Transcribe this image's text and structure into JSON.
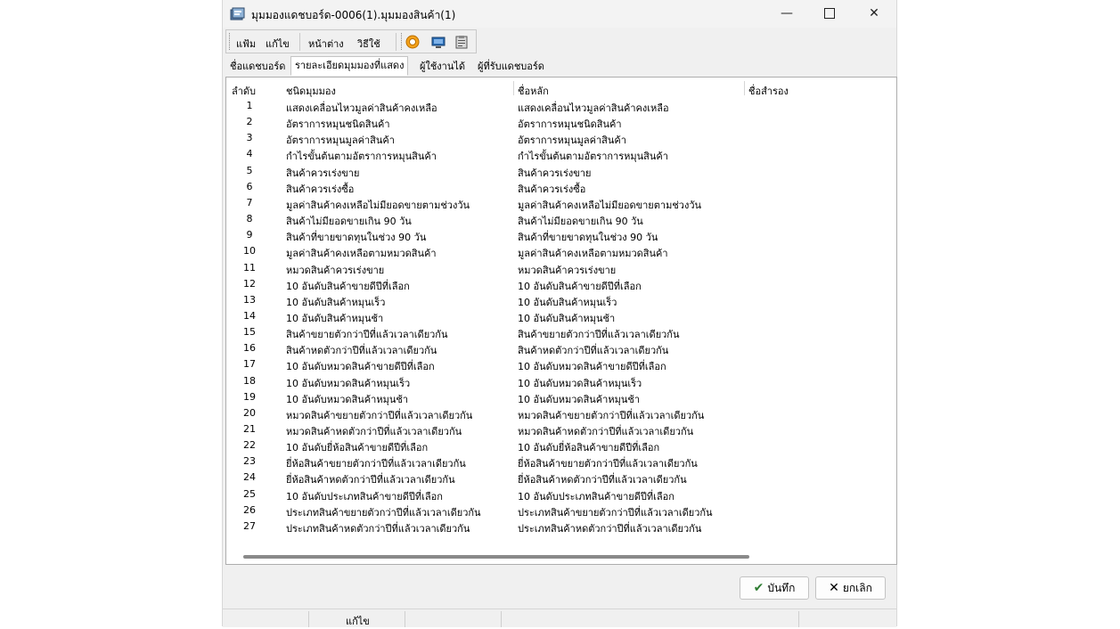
{
  "window": {
    "title": "มุมมองแดชบอร์ด-0006(1).มุมมองสินค้า(1)"
  },
  "controls": {
    "minimize": "—",
    "close": "✕"
  },
  "menu": {
    "file": "แฟ้ม",
    "edit": "แก้ไข",
    "window": "หน้าต่าง",
    "help": "วิธีใช้"
  },
  "tabs": [
    "ชื่อแดชบอร์ด",
    "รายละเอียดมุมมองที่แสดง",
    "ผู้ใช้งานได้",
    "ผู้ที่รับแดชบอร์ด"
  ],
  "grid": {
    "headers": {
      "seq": "ลำดับ",
      "type": "ชนิดมุมมอง",
      "main_name": "ชื่อหลัก",
      "alt_name": "ชื่อสำรอง"
    },
    "rows": [
      {
        "seq": "1",
        "type": "แสดงเคลื่อนไหวมูลค่าสินค้าคงเหลือ",
        "main": "แสดงเคลื่อนไหวมูลค่าสินค้าคงเหลือ"
      },
      {
        "seq": "2",
        "type": "อัตราการหมุนชนิดสินค้า",
        "main": "อัตราการหมุนชนิดสินค้า"
      },
      {
        "seq": "3",
        "type": "อัตราการหมุนมูลค่าสินค้า",
        "main": "อัตราการหมุนมูลค่าสินค้า"
      },
      {
        "seq": "4",
        "type": "กำไรขั้นต้นตามอัตราการหมุนสินค้า",
        "main": "กำไรขั้นต้นตามอัตราการหมุนสินค้า"
      },
      {
        "seq": "5",
        "type": "สินค้าควรเร่งขาย",
        "main": "สินค้าควรเร่งขาย"
      },
      {
        "seq": "6",
        "type": "สินค้าควรเร่งซื้อ",
        "main": "สินค้าควรเร่งซื้อ"
      },
      {
        "seq": "7",
        "type": "มูลค่าสินค้าคงเหลือไม่มียอดขายตามช่วงวัน",
        "main": "มูลค่าสินค้าคงเหลือไม่มียอดขายตามช่วงวัน"
      },
      {
        "seq": "8",
        "type": "สินค้าไม่มียอดขายเกิน 90 วัน",
        "main": "สินค้าไม่มียอดขายเกิน 90 วัน"
      },
      {
        "seq": "9",
        "type": "สินค้าที่ขายขาดทุนในช่วง 90 วัน",
        "main": "สินค้าที่ขายขาดทุนในช่วง 90 วัน"
      },
      {
        "seq": "10",
        "type": "มูลค่าสินค้าคงเหลือตามหมวดสินค้า",
        "main": "มูลค่าสินค้าคงเหลือตามหมวดสินค้า"
      },
      {
        "seq": "11",
        "type": "หมวดสินค้าควรเร่งขาย",
        "main": "หมวดสินค้าควรเร่งขาย"
      },
      {
        "seq": "12",
        "type": "10 อันดับสินค้าขายดีปีที่เลือก",
        "main": "10 อันดับสินค้าขายดีปีที่เลือก"
      },
      {
        "seq": "13",
        "type": "10 อันดับสินค้าหมุนเร็ว",
        "main": "10 อันดับสินค้าหมุนเร็ว"
      },
      {
        "seq": "14",
        "type": "10 อันดับสินค้าหมุนช้า",
        "main": "10 อันดับสินค้าหมุนช้า"
      },
      {
        "seq": "15",
        "type": "สินค้าขยายตัวกว่าปีที่แล้วเวลาเดียวกัน",
        "main": "สินค้าขยายตัวกว่าปีที่แล้วเวลาเดียวกัน"
      },
      {
        "seq": "16",
        "type": "สินค้าหดตัวกว่าปีที่แล้วเวลาเดียวกัน",
        "main": "สินค้าหดตัวกว่าปีที่แล้วเวลาเดียวกัน"
      },
      {
        "seq": "17",
        "type": "10 อันดับหมวดสินค้าขายดีปีที่เลือก",
        "main": "10 อันดับหมวดสินค้าขายดีปีที่เลือก"
      },
      {
        "seq": "18",
        "type": "10 อันดับหมวดสินค้าหมุนเร็ว",
        "main": "10 อันดับหมวดสินค้าหมุนเร็ว"
      },
      {
        "seq": "19",
        "type": "10 อันดับหมวดสินค้าหมุนช้า",
        "main": "10 อันดับหมวดสินค้าหมุนช้า"
      },
      {
        "seq": "20",
        "type": "หมวดสินค้าขยายตัวกว่าปีที่แล้วเวลาเดียวกัน",
        "main": "หมวดสินค้าขยายตัวกว่าปีที่แล้วเวลาเดียวกัน"
      },
      {
        "seq": "21",
        "type": "หมวดสินค้าหดตัวกว่าปีที่แล้วเวลาเดียวกัน",
        "main": "หมวดสินค้าหดตัวกว่าปีที่แล้วเวลาเดียวกัน"
      },
      {
        "seq": "22",
        "type": "10 อันดับยี่ห้อสินค้าขายดีปีที่เลือก",
        "main": "10 อันดับยี่ห้อสินค้าขายดีปีที่เลือก"
      },
      {
        "seq": "23",
        "type": "ยี่ห้อสินค้าขยายตัวกว่าปีที่แล้วเวลาเดียวกัน",
        "main": "ยี่ห้อสินค้าขยายตัวกว่าปีที่แล้วเวลาเดียวกัน"
      },
      {
        "seq": "24",
        "type": "ยี่ห้อสินค้าหดตัวกว่าปีที่แล้วเวลาเดียวกัน",
        "main": "ยี่ห้อสินค้าหดตัวกว่าปีที่แล้วเวลาเดียวกัน"
      },
      {
        "seq": "25",
        "type": "10 อันดับประเภทสินค้าขายดีปีที่เลือก",
        "main": "10 อันดับประเภทสินค้าขายดีปีที่เลือก"
      },
      {
        "seq": "26",
        "type": "ประเภทสินค้าขยายตัวกว่าปีที่แล้วเวลาเดียวกัน",
        "main": "ประเภทสินค้าขยายตัวกว่าปีที่แล้วเวลาเดียวกัน"
      },
      {
        "seq": "27",
        "type": "ประเภทสินค้าหดตัวกว่าปีที่แล้วเวลาเดียวกัน",
        "main": "ประเภทสินค้าหดตัวกว่าปีที่แล้วเวลาเดียวกัน"
      }
    ]
  },
  "buttons": {
    "save": "บันทึก",
    "cancel": "ยกเลิก"
  },
  "status": {
    "mode": "แก้ไข"
  },
  "icons": {
    "save": "check-icon",
    "cancel": "x-icon"
  },
  "colors": {
    "save_check": "#2e7d32",
    "accent_orange": "#e08a00",
    "icon_blue": "#2a6db5"
  }
}
